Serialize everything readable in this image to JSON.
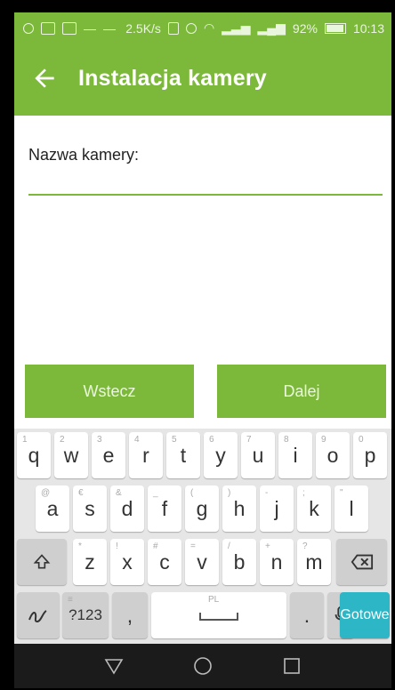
{
  "status_bar": {
    "speed": "2.5K/s",
    "battery": "92%",
    "time": "10:13"
  },
  "app_bar": {
    "title": "Instalacja kamery"
  },
  "form": {
    "name_label": "Nazwa kamery:",
    "name_value": ""
  },
  "buttons": {
    "back": "Wstecz",
    "next": "Dalej"
  },
  "keyboard": {
    "row1": [
      {
        "key": "q",
        "hint": "1"
      },
      {
        "key": "w",
        "hint": "2"
      },
      {
        "key": "e",
        "hint": "3"
      },
      {
        "key": "r",
        "hint": "4"
      },
      {
        "key": "t",
        "hint": "5"
      },
      {
        "key": "y",
        "hint": "6"
      },
      {
        "key": "u",
        "hint": "7"
      },
      {
        "key": "i",
        "hint": "8"
      },
      {
        "key": "o",
        "hint": "9"
      },
      {
        "key": "p",
        "hint": "0"
      }
    ],
    "row2": [
      {
        "key": "a",
        "hint": "@"
      },
      {
        "key": "s",
        "hint": "€"
      },
      {
        "key": "d",
        "hint": "&"
      },
      {
        "key": "f",
        "hint": "_"
      },
      {
        "key": "g",
        "hint": "("
      },
      {
        "key": "h",
        "hint": ")"
      },
      {
        "key": "j",
        "hint": "-"
      },
      {
        "key": "k",
        "hint": ";"
      },
      {
        "key": "l",
        "hint": "\""
      }
    ],
    "row3": [
      {
        "key": "z",
        "hint": "*"
      },
      {
        "key": "x",
        "hint": "!"
      },
      {
        "key": "c",
        "hint": "#"
      },
      {
        "key": "v",
        "hint": "="
      },
      {
        "key": "b",
        "hint": "/"
      },
      {
        "key": "n",
        "hint": "+"
      },
      {
        "key": "m",
        "hint": "?"
      }
    ],
    "symbols_key": "?123",
    "comma_key": ",",
    "space_hint": "PL",
    "period_key": ".",
    "done_key": "Gotowe"
  },
  "colors": {
    "accent": "#7cb93a",
    "done": "#2db6c6"
  }
}
